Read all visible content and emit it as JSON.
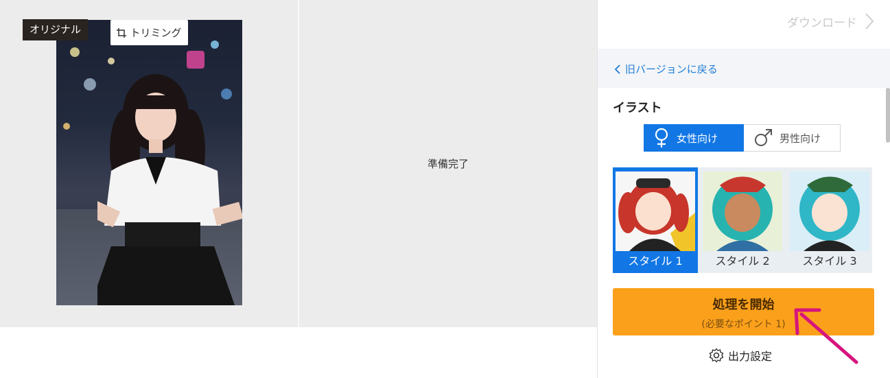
{
  "left": {
    "original_tag": "オリジナル",
    "trim_button": "トリミング",
    "result_status": "準備完了"
  },
  "sidebar": {
    "download_label": "ダウンロード",
    "back_link": "旧バージョンに戻る",
    "section_title": "イラスト",
    "gender": {
      "female": "女性向け",
      "male": "男性向け",
      "selected": "female"
    },
    "styles": [
      {
        "label": "スタイル 1",
        "selected": true
      },
      {
        "label": "スタイル 2",
        "selected": false
      },
      {
        "label": "スタイル 3",
        "selected": false
      }
    ],
    "start_button": {
      "label": "処理を開始",
      "sub": "(必要なポイント 1)"
    },
    "output_settings": "出力設定"
  },
  "colors": {
    "accent_blue": "#1277e5",
    "start_orange": "#fba01b",
    "link_blue": "#1e7bd6",
    "annotation_arrow": "#d6157d"
  }
}
